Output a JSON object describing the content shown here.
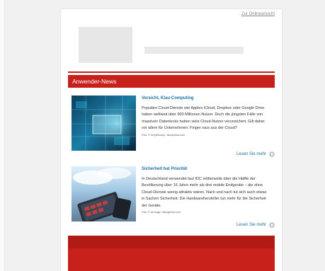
{
  "header": {
    "online_link": "Zur Onlineansicht"
  },
  "section": {
    "title": "Anwender-News"
  },
  "articles": [
    {
      "title": "Vorsicht, Klau-Computing",
      "body": "Populäre Cloud-Dienste wie Apples iCloud, Dropbox oder Google Drive haben weltweit über 900 Millionen Nutzer. Doch die jüngsten Fälle von massiven Datenlecks haben viele Cloud-Nutzer verunsichert. Gilt daher vor allem für Unternehmen: Finger raus aus der Cloud?",
      "credit": "Foto: © Greyfebruary / istockphoto.com",
      "read_more": "Lesen Sie mehr"
    },
    {
      "title": "Sicherheit hat Priorität",
      "body": "In Deutschland verwendet laut IDC mittlerweile über die Hälfte der Bevölkerung über 16 Jahre mehr als drei mobile Endgeräte – die ohne Cloud-Dienste wenig attraktiv wären. Nach und nach tut sich auch etwas in Sachen Sicherheit: Die Hardwarehersteller tun mehr für die Sicherheit der Geräte.",
      "credit": "Foto: © vit-image / istockphoto.com",
      "read_more": "Lesen Sie mehr"
    }
  ],
  "colors": {
    "brand_red": "#c8201b",
    "link_blue": "#1c6fa3"
  },
  "icons": {
    "read_more": "arrow-circle-icon"
  }
}
